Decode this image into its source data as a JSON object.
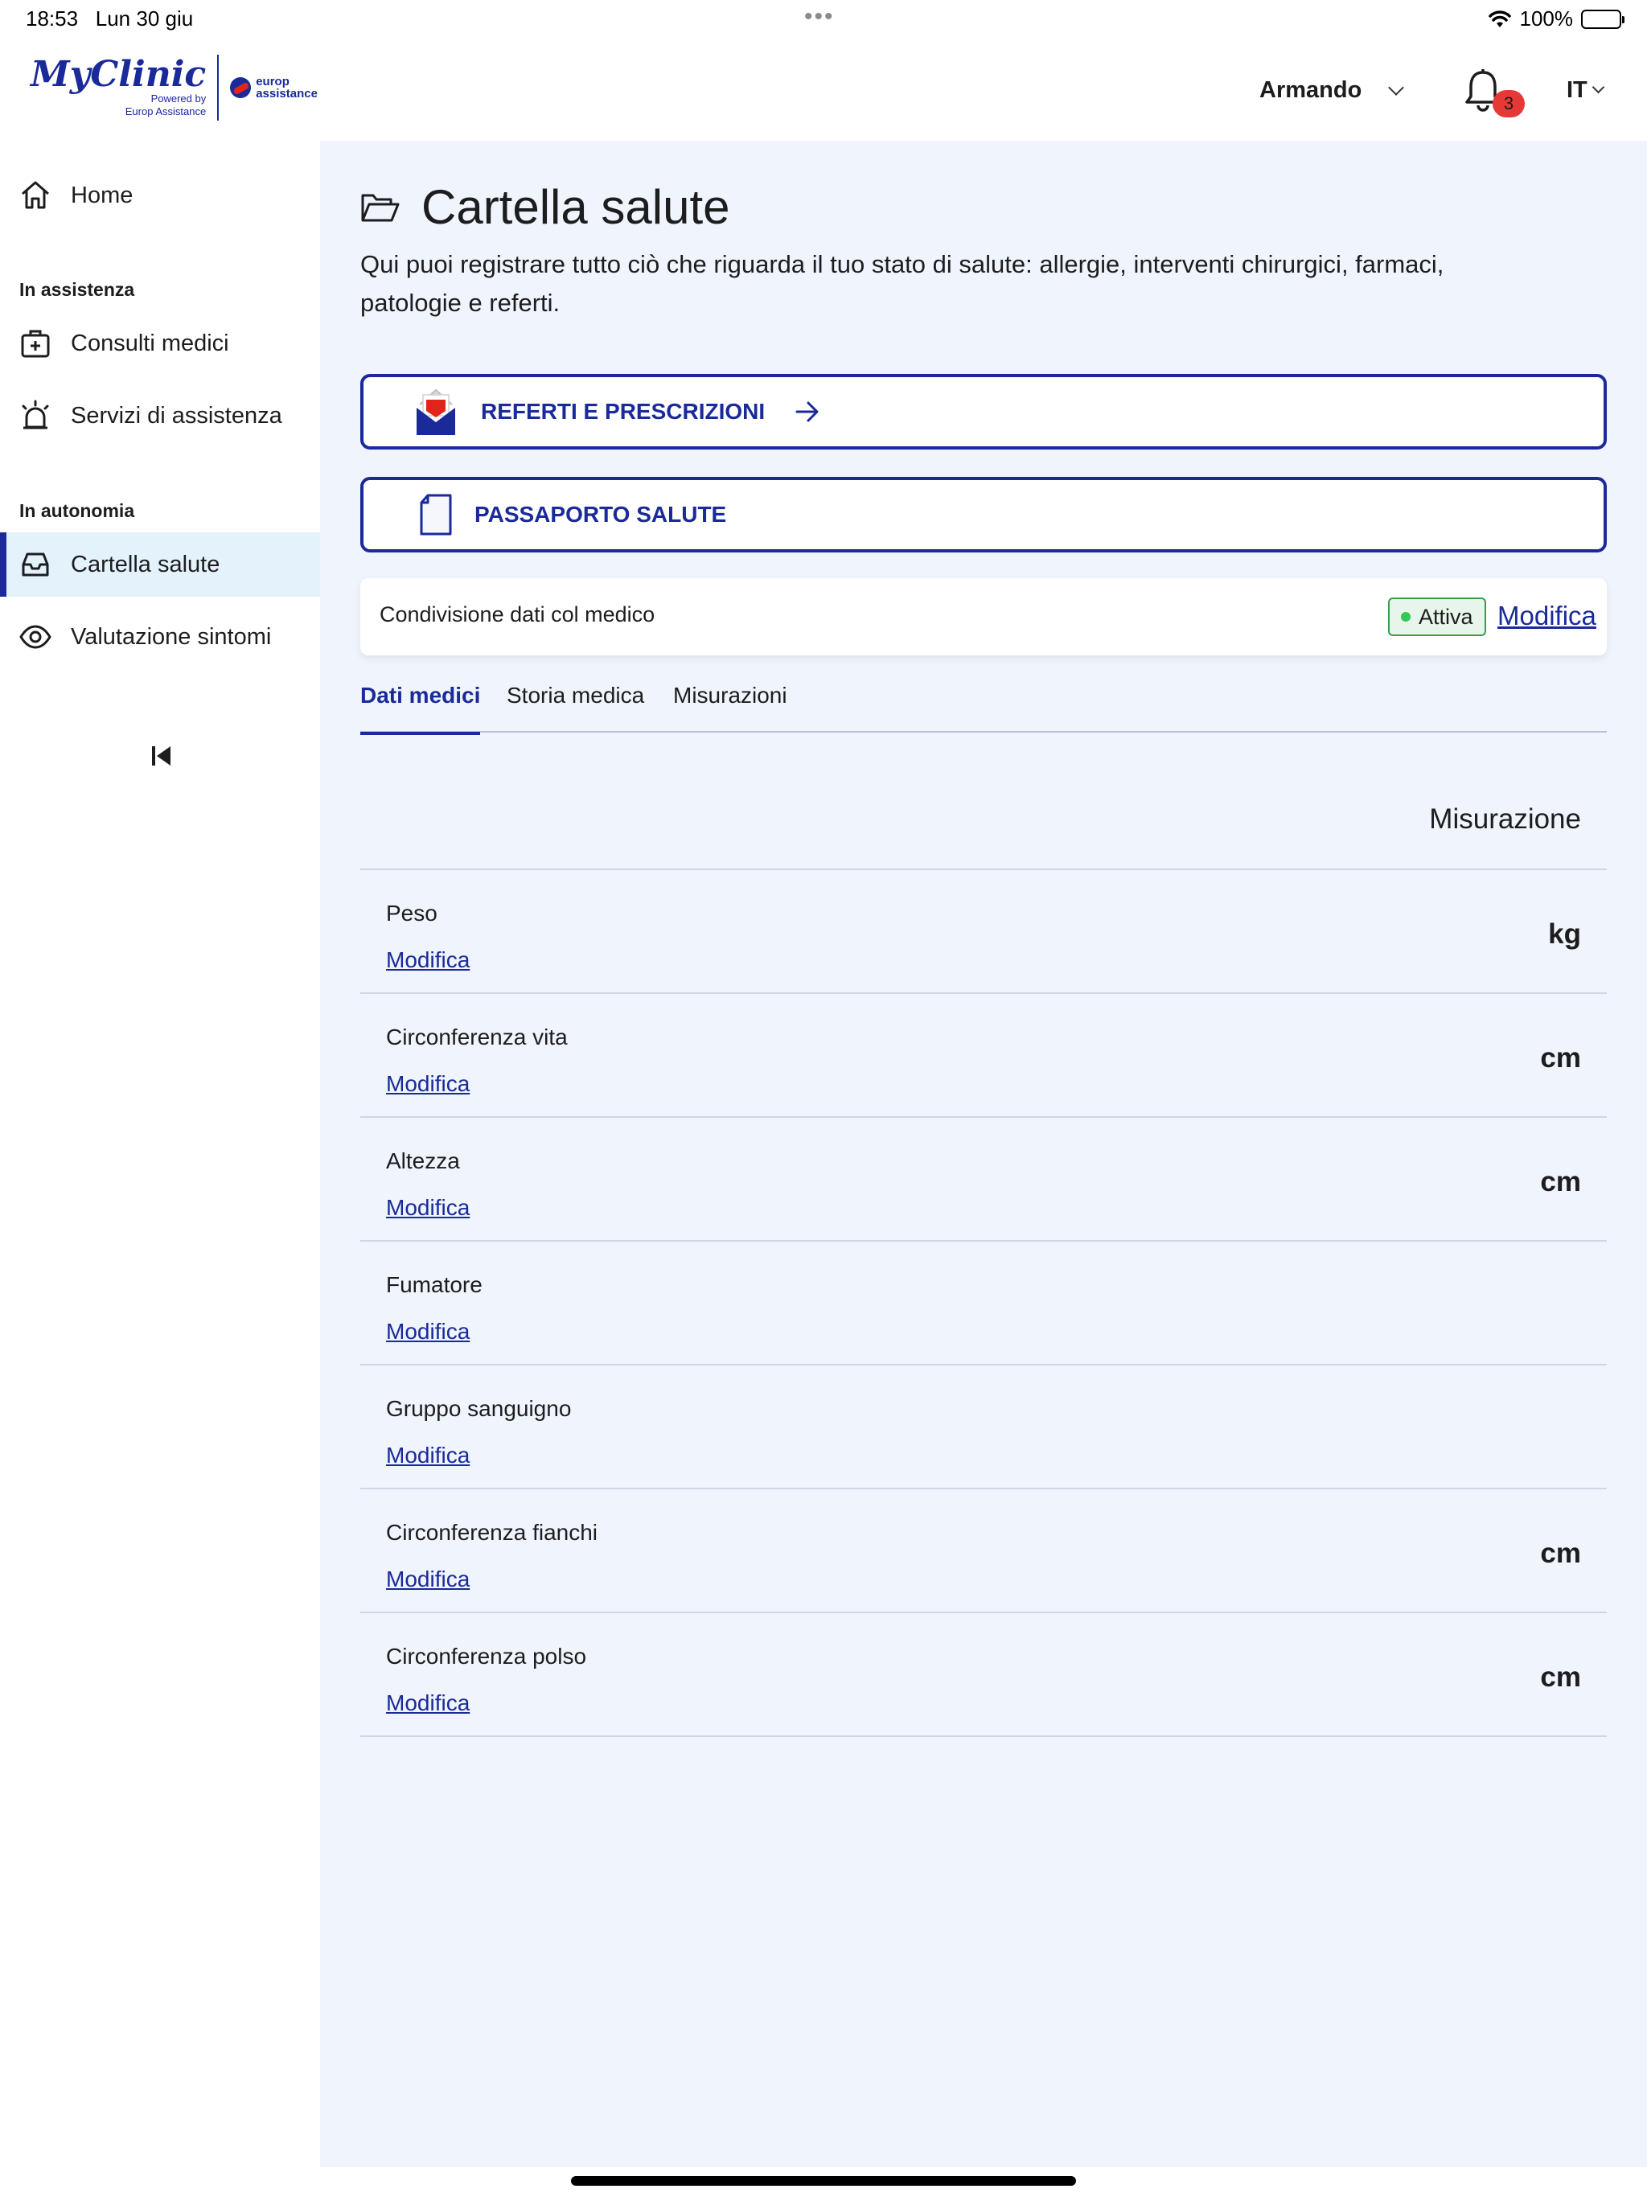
{
  "status_bar": {
    "time": "18:53",
    "date": "Lun 30 giu",
    "dots": "•••",
    "battery": "100%"
  },
  "header": {
    "logo": {
      "brand": "MyClinic",
      "powered_line1": "Powered by",
      "powered_line2": "Europ Assistance",
      "partner_line1": "europ",
      "partner_line2": "assistance"
    },
    "user_name": "Armando",
    "notifications_count": "3",
    "language": "IT"
  },
  "sidebar": {
    "home": "Home",
    "section_assistenza": "In assistenza",
    "consulti": "Consulti medici",
    "servizi": "Servizi di assistenza",
    "section_autonomia": "In autonomia",
    "cartella": "Cartella salute",
    "valutazione": "Valutazione sintomi"
  },
  "main": {
    "title": "Cartella salute",
    "description": "Qui puoi registrare tutto ciò che riguarda il tuo stato di salute: allergie, interventi chirurgici, farmaci, patologie e referti.",
    "referti_button": "REFERTI E PRESCRIZIONI",
    "passaporto_button": "PASSAPORTO SALUTE",
    "share": {
      "label": "Condivisione dati col medico",
      "status": "Attiva",
      "edit": "Modifica"
    },
    "tabs": [
      "Dati medici",
      "Storia medica",
      "Misurazioni"
    ],
    "column_header": "Misurazione",
    "rows": [
      {
        "name": "Peso",
        "edit": "Modifica",
        "unit": "kg"
      },
      {
        "name": "Circonferenza vita",
        "edit": "Modifica",
        "unit": "cm"
      },
      {
        "name": "Altezza",
        "edit": "Modifica",
        "unit": "cm"
      },
      {
        "name": "Fumatore",
        "edit": "Modifica",
        "unit": ""
      },
      {
        "name": "Gruppo sanguigno",
        "edit": "Modifica",
        "unit": ""
      },
      {
        "name": "Circonferenza fianchi",
        "edit": "Modifica",
        "unit": "cm"
      },
      {
        "name": "Circonferenza polso",
        "edit": "Modifica",
        "unit": "cm"
      }
    ]
  },
  "colors": {
    "brand": "#1a2a9a",
    "active_bg": "#e3f2fb",
    "main_bg": "#f0f4fc",
    "badge": "#e53935",
    "status_green": "#3b9c4d"
  }
}
